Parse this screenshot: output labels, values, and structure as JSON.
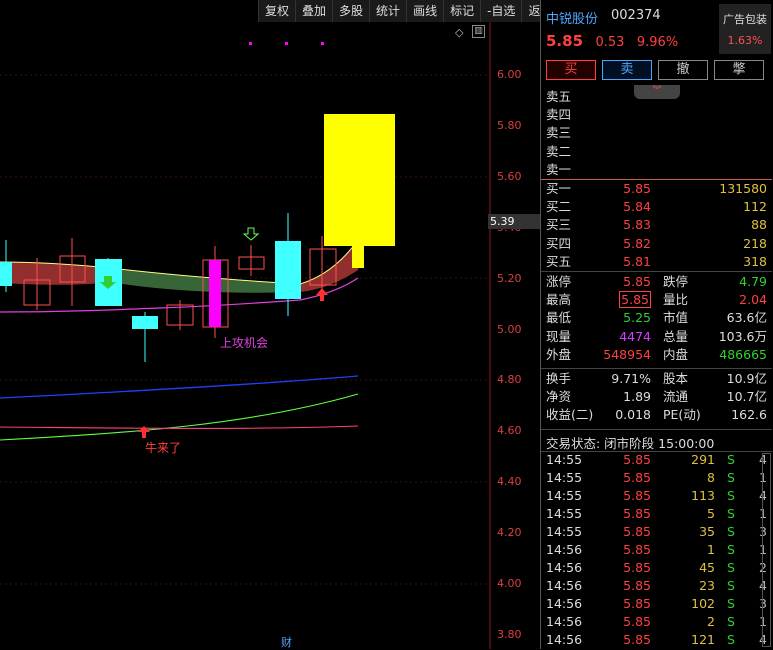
{
  "toolbar": {
    "buttons": [
      "复权",
      "叠加",
      "多股",
      "统计",
      "画线",
      "标记",
      "-自选",
      "返回"
    ]
  },
  "chart": {
    "y_axis_labels": [
      "6.00",
      "5.80",
      "5.60",
      "5.40",
      "5.20",
      "5.00",
      "4.80",
      "4.60",
      "4.40",
      "4.20",
      "4.00",
      "3.80"
    ],
    "current_price_tag": "5.39",
    "annotations": {
      "attack": "上攻机会",
      "bull": "牛来了",
      "finance_marker": "财"
    },
    "colors": {
      "up_candle": "#ff5050",
      "down_candle": "#40ffff",
      "limit_up": "#ffff00",
      "magenta": "#ff00ff",
      "ma_blue": "#2040ff",
      "ma_green": "#60ff40",
      "ma_pink": "#ff4080"
    }
  },
  "quote": {
    "name": "中锐股份",
    "code": "002374",
    "last": "5.85",
    "change": "0.53",
    "change_pct": "9.96%",
    "ad_title": "广告包装",
    "ad_pct": "1.63%"
  },
  "trade_buttons": [
    "买",
    "卖",
    "撤",
    "撆"
  ],
  "asks": [
    {
      "label": "卖五",
      "price": "",
      "volume": ""
    },
    {
      "label": "卖四",
      "price": "",
      "volume": ""
    },
    {
      "label": "卖三",
      "price": "",
      "volume": ""
    },
    {
      "label": "卖二",
      "price": "",
      "volume": ""
    },
    {
      "label": "卖一",
      "price": "",
      "volume": ""
    }
  ],
  "bids": [
    {
      "label": "买一",
      "price": "5.85",
      "volume": "131580"
    },
    {
      "label": "买二",
      "price": "5.84",
      "volume": "112"
    },
    {
      "label": "买三",
      "price": "5.83",
      "volume": "88"
    },
    {
      "label": "买四",
      "price": "5.82",
      "volume": "218"
    },
    {
      "label": "买五",
      "price": "5.81",
      "volume": "318"
    }
  ],
  "stats1": [
    {
      "l1": "涨停",
      "v1": "5.85",
      "c1": "red",
      "l2": "跌停",
      "v2": "4.79",
      "c2": "green"
    },
    {
      "l1": "最高",
      "v1": "5.85",
      "c1": "red boxed",
      "l2": "量比",
      "v2": "2.04",
      "c2": "red"
    },
    {
      "l1": "最低",
      "v1": "5.25",
      "c1": "green",
      "l2": "市值",
      "v2": "63.6亿",
      "c2": "white"
    },
    {
      "l1": "现量",
      "v1": "4474",
      "c1": "purple",
      "l2": "总量",
      "v2": "103.6万",
      "c2": "white"
    },
    {
      "l1": "外盘",
      "v1": "548954",
      "c1": "red",
      "l2": "内盘",
      "v2": "486665",
      "c2": "green"
    }
  ],
  "stats2": [
    {
      "l1": "换手",
      "v1": "9.71%",
      "c1": "white",
      "l2": "股本",
      "v2": "10.9亿",
      "c2": "white"
    },
    {
      "l1": "净资",
      "v1": "1.89",
      "c1": "white",
      "l2": "流通",
      "v2": "10.7亿",
      "c2": "white"
    },
    {
      "l1": "收益(二)",
      "v1": "0.018",
      "c1": "white",
      "l2": "PE(动)",
      "v2": "162.6",
      "c2": "white"
    }
  ],
  "status_text": "交易状态: 闭市阶段 15:00:00",
  "ticks": [
    {
      "t": "14:55",
      "p": "5.85",
      "v": "291",
      "s": "S",
      "n": "4"
    },
    {
      "t": "14:55",
      "p": "5.85",
      "v": "8",
      "s": "S",
      "n": "1"
    },
    {
      "t": "14:55",
      "p": "5.85",
      "v": "113",
      "s": "S",
      "n": "4"
    },
    {
      "t": "14:55",
      "p": "5.85",
      "v": "5",
      "s": "S",
      "n": "1"
    },
    {
      "t": "14:55",
      "p": "5.85",
      "v": "35",
      "s": "S",
      "n": "3"
    },
    {
      "t": "14:56",
      "p": "5.85",
      "v": "1",
      "s": "S",
      "n": "1"
    },
    {
      "t": "14:56",
      "p": "5.85",
      "v": "45",
      "s": "S",
      "n": "2"
    },
    {
      "t": "14:56",
      "p": "5.85",
      "v": "23",
      "s": "S",
      "n": "4"
    },
    {
      "t": "14:56",
      "p": "5.85",
      "v": "102",
      "s": "S",
      "n": "3"
    },
    {
      "t": "14:56",
      "p": "5.85",
      "v": "2",
      "s": "S",
      "n": "1"
    },
    {
      "t": "14:56",
      "p": "5.85",
      "v": "121",
      "s": "S",
      "n": "4"
    }
  ]
}
